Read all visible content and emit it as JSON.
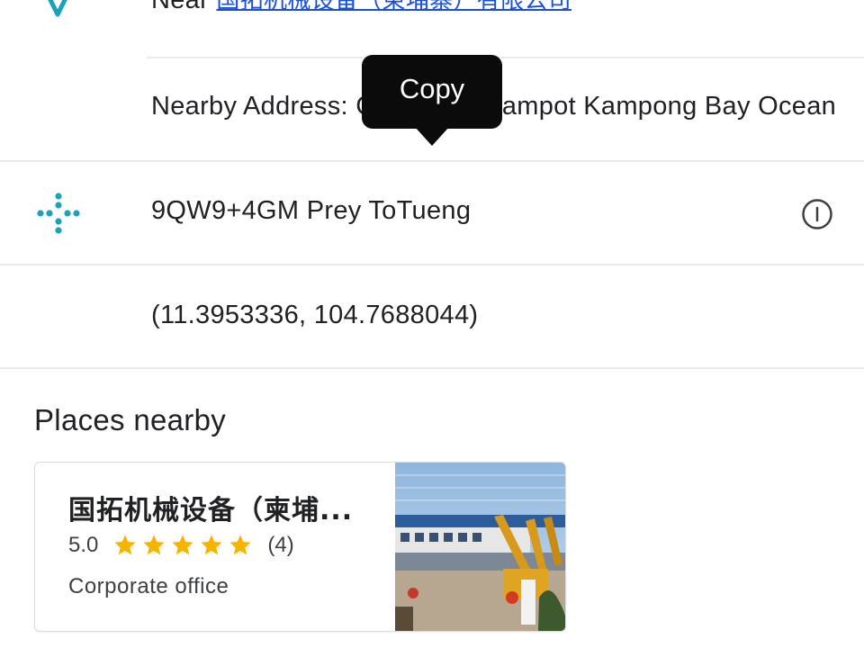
{
  "address_row": {
    "prefix": "Near",
    "link_text": "国拓机械设备（柬埔寨）有限公司"
  },
  "nearby_row": {
    "text": "Nearby Address: Cambodia Kampot Kampong Bay Ocean"
  },
  "tooltip": {
    "label": "Copy"
  },
  "plus_code_row": {
    "text": "9QW9+4GM Prey ToTueng"
  },
  "coords_row": {
    "text": "(11.3953336, 104.7688044)"
  },
  "places_nearby": {
    "title": "Places nearby",
    "cards": [
      {
        "name": "国拓机械设备（柬埔...",
        "rating": "5.0",
        "stars": 5,
        "review_count": "(4)",
        "category": "Corporate office"
      }
    ]
  },
  "colors": {
    "pin": "#1aa3b8",
    "plus_code_icon": "#1aa3b8",
    "link": "#1a4fd6",
    "star": "#f5b400"
  }
}
